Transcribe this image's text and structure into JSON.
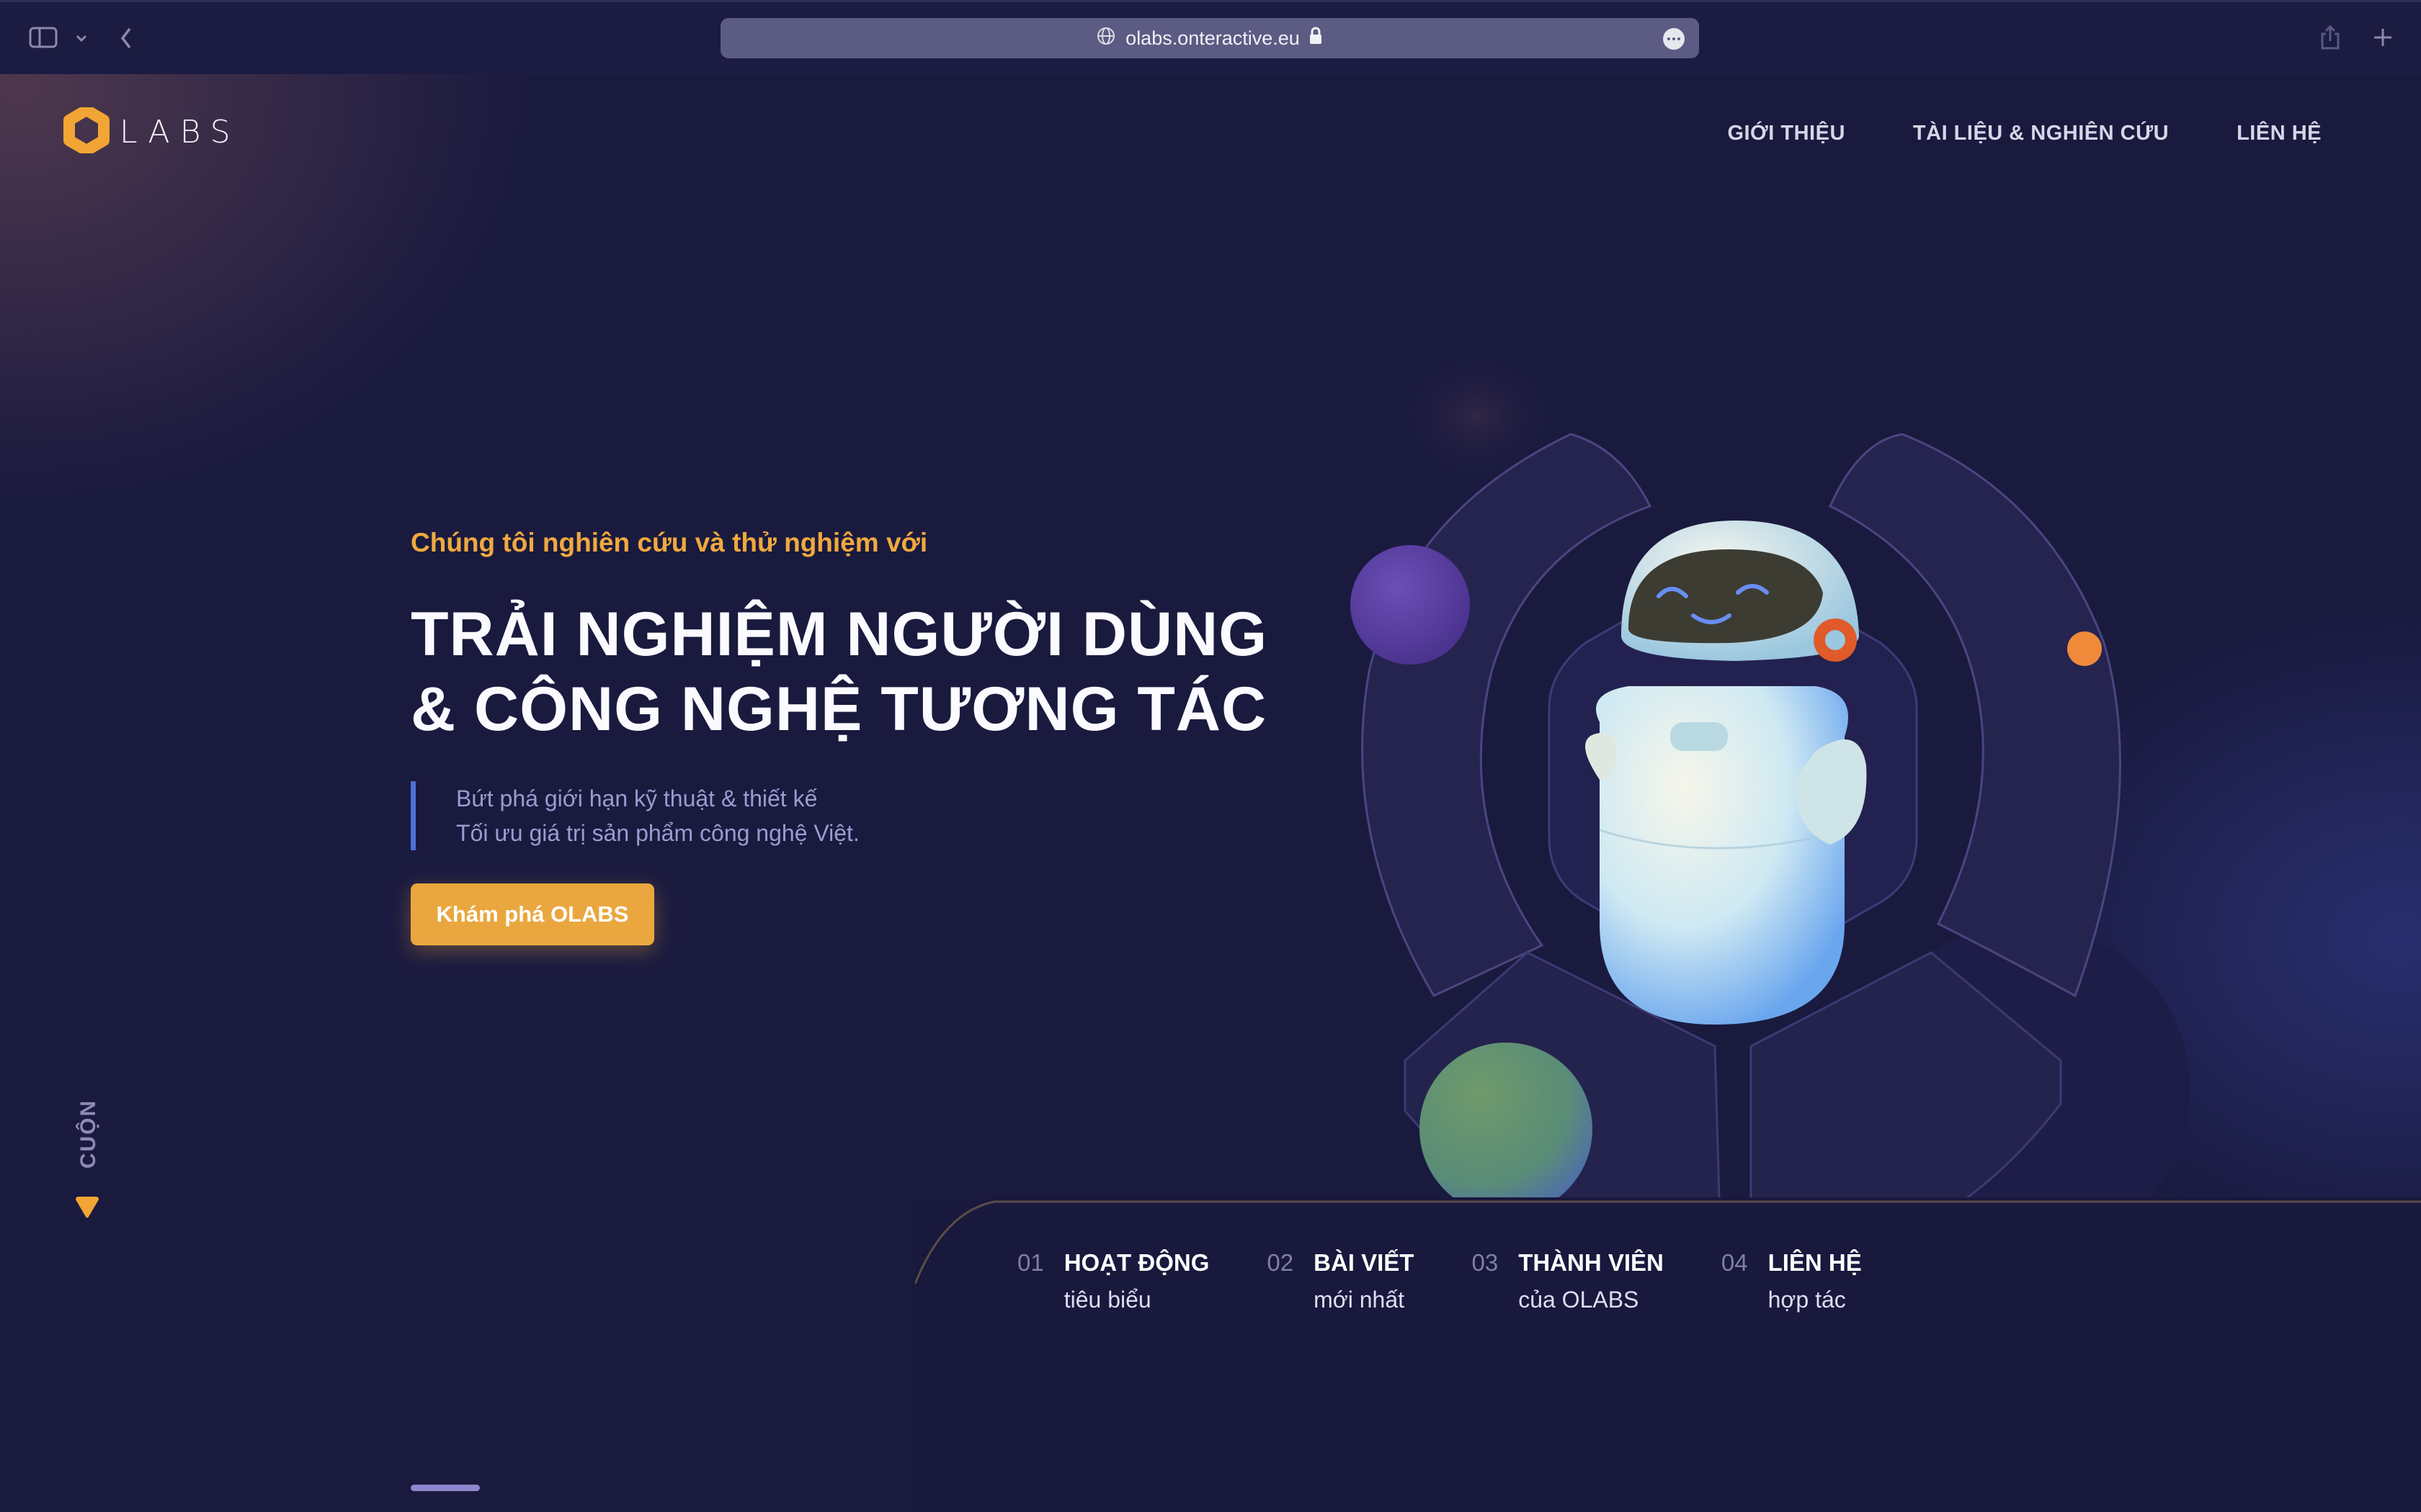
{
  "browser": {
    "url": "olabs.onteractive.eu",
    "icons": {
      "sidebar": "sidebar-icon",
      "sidebar_menu": "chevron-down-icon",
      "back": "chevron-left-icon",
      "site": "globe-icon",
      "secure": "lock-icon",
      "more": "ellipsis-icon",
      "share": "share-icon",
      "new_tab": "plus-icon"
    }
  },
  "header": {
    "logo_text": "LABS",
    "nav": [
      "GIỚI THIỆU",
      "TÀI LIỆU & NGHIÊN CỨU",
      "LIÊN HỆ"
    ]
  },
  "hero": {
    "kicker": "Chúng tôi nghiên cứu và thử nghiệm với",
    "headline_line1": "TRẢI NGHIỆM NGƯỜI DÙNG",
    "headline_line2": "& CÔNG NGHỆ TƯƠNG TÁC",
    "sub_line1": "Bứt phá giới hạn kỹ thuật & thiết kế",
    "sub_line2": "Tối ưu giá trị sản phẩm công nghệ Việt.",
    "cta": "Khám phá OLABS"
  },
  "scroll": {
    "label": "CUỘN"
  },
  "tabs": [
    {
      "num": "01",
      "title": "HOẠT ĐỘNG",
      "sub": "tiêu biểu"
    },
    {
      "num": "02",
      "title": "BÀI VIẾT",
      "sub": "mới nhất"
    },
    {
      "num": "03",
      "title": "THÀNH VIÊN",
      "sub": "của OLABS"
    },
    {
      "num": "04",
      "title": "LIÊN HỆ",
      "sub": "hợp tác"
    }
  ],
  "colors": {
    "background": "#1a1a3f",
    "accent": "#eaa73f",
    "kicker": "#f0a93d",
    "subtext": "#9a9cd0",
    "quote_bar": "#4a6fd6"
  }
}
